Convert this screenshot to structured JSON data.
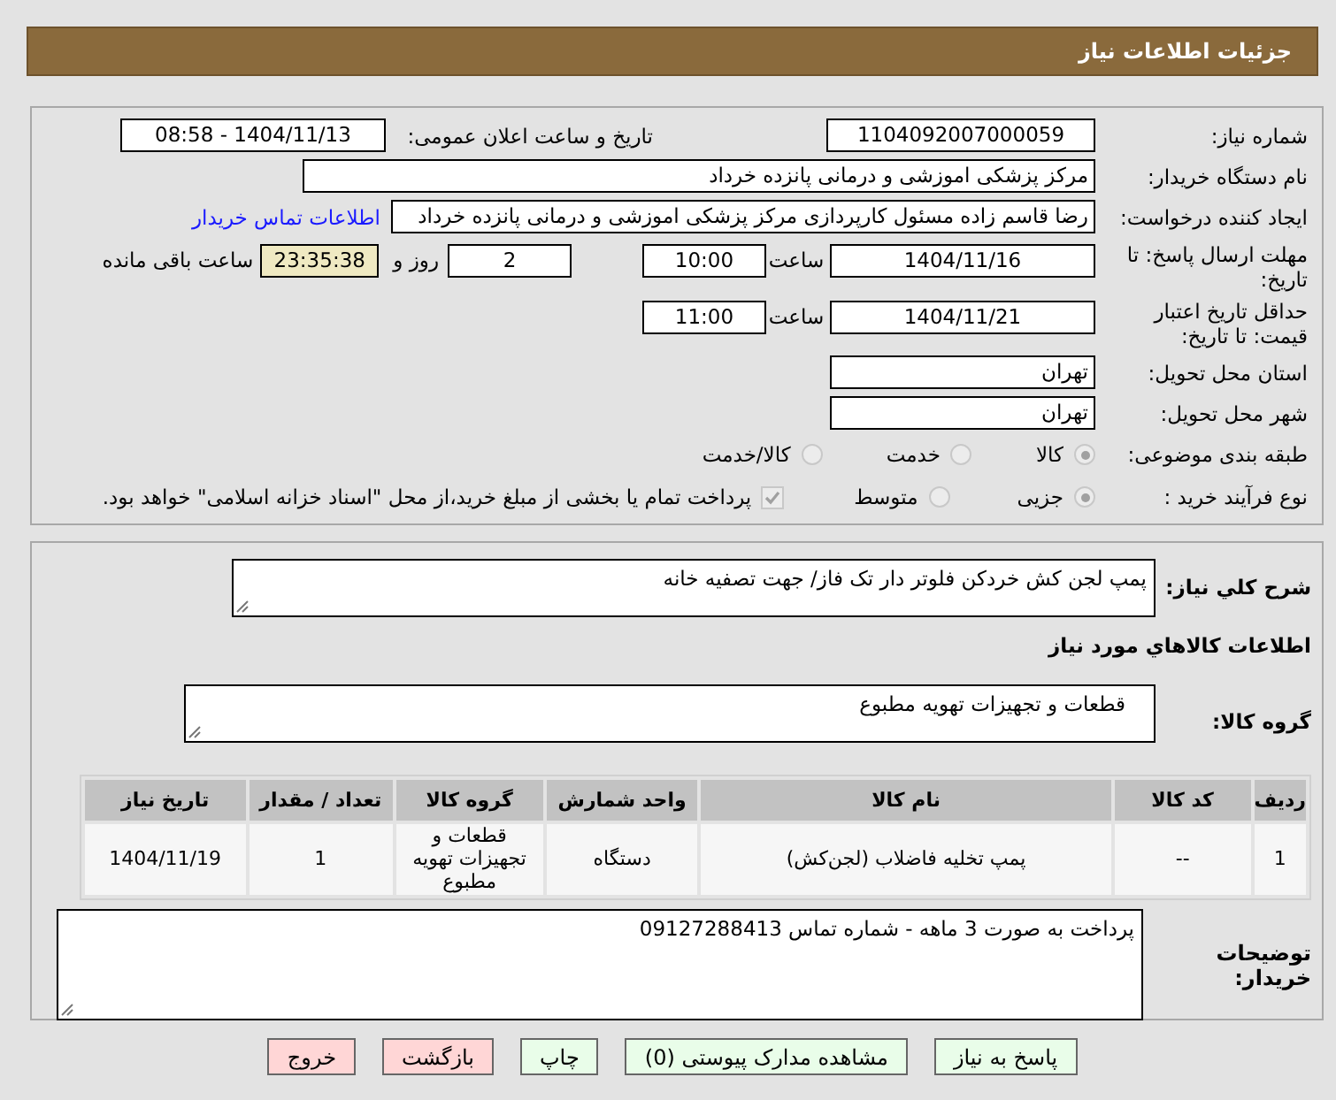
{
  "header": {
    "title": "جزئیات اطلاعات نیاز"
  },
  "need_number": {
    "label": "شماره نیاز:",
    "value": "1104092007000059"
  },
  "announce": {
    "label": "تاریخ و ساعت اعلان عمومی:",
    "value": "1404/11/13 - 08:58"
  },
  "buyer_org": {
    "label": "نام دستگاه خریدار:",
    "value": "مرکز پزشکی  اموزشی و درمانی پانزده خرداد"
  },
  "requester": {
    "label": "ایجاد کننده درخواست:",
    "value": "رضا قاسم زاده مسئول کارپردازی مرکز پزشکی  اموزشی و درمانی پانزده خرداد",
    "link": "اطلاعات تماس خریدار"
  },
  "deadline": {
    "label": "مهلت ارسال پاسخ: تا تاریخ:",
    "date": "1404/11/16",
    "time_label": "ساعت",
    "time": "10:00",
    "days": "2",
    "days_label": "روز و",
    "remaining": "23:35:38",
    "remaining_label": "ساعت باقی مانده"
  },
  "validity": {
    "label": "حداقل تاریخ اعتبار قیمت: تا تاریخ:",
    "date": "1404/11/21",
    "time_label": "ساعت",
    "time": "11:00"
  },
  "province": {
    "label": "استان محل تحویل:",
    "value": "تهران"
  },
  "city": {
    "label": "شهر محل تحویل:",
    "value": "تهران"
  },
  "category": {
    "label": "طبقه بندی موضوعی:",
    "options": [
      {
        "label": "کالا",
        "selected": true
      },
      {
        "label": "خدمت",
        "selected": false
      },
      {
        "label": "کالا/خدمت",
        "selected": false
      }
    ]
  },
  "process": {
    "label": "نوع فرآیند خرید :",
    "options": [
      {
        "label": "جزیی",
        "selected": true
      },
      {
        "label": "متوسط",
        "selected": false
      }
    ],
    "treasury": {
      "label": "پرداخت تمام یا بخشی از مبلغ خرید،از محل \"اسناد خزانه اسلامی\" خواهد بود.",
      "checked": true
    }
  },
  "description": {
    "label": "شرح کلي نياز:",
    "value": "پمپ لجن کش خردکن فلوتر دار تک فاز/ جهت تصفیه خانه"
  },
  "goods_heading": "اطلاعات کالاهاي مورد نياز",
  "goods_group": {
    "label": "گروه کالا:",
    "value": "قطعات و تجهیزات تهویه مطبوع"
  },
  "table": {
    "columns": [
      "ردیف",
      "کد کالا",
      "نام کالا",
      "واحد شمارش",
      "گروه کالا",
      "تعداد / مقدار",
      "تاریخ نیاز"
    ],
    "rows": [
      [
        "1",
        "--",
        "پمپ تخلیه فاضلاب (لجن‌کش)",
        "دستگاه",
        "قطعات و تجهیزات تهویه مطبوع",
        "1",
        "1404/11/19"
      ]
    ]
  },
  "buyer_notes": {
    "label": "توضیحات خریدار:",
    "value": "پرداخت به صورت 3 ماهه - شماره تماس 09127288413"
  },
  "buttons": [
    {
      "label": "پاسخ به نیاز",
      "kind": "normal"
    },
    {
      "label": "مشاهده مدارک پیوستی (0)",
      "kind": "normal"
    },
    {
      "label": "چاپ",
      "kind": "normal"
    },
    {
      "label": "بازگشت",
      "kind": "danger"
    },
    {
      "label": "خروج",
      "kind": "danger"
    }
  ]
}
